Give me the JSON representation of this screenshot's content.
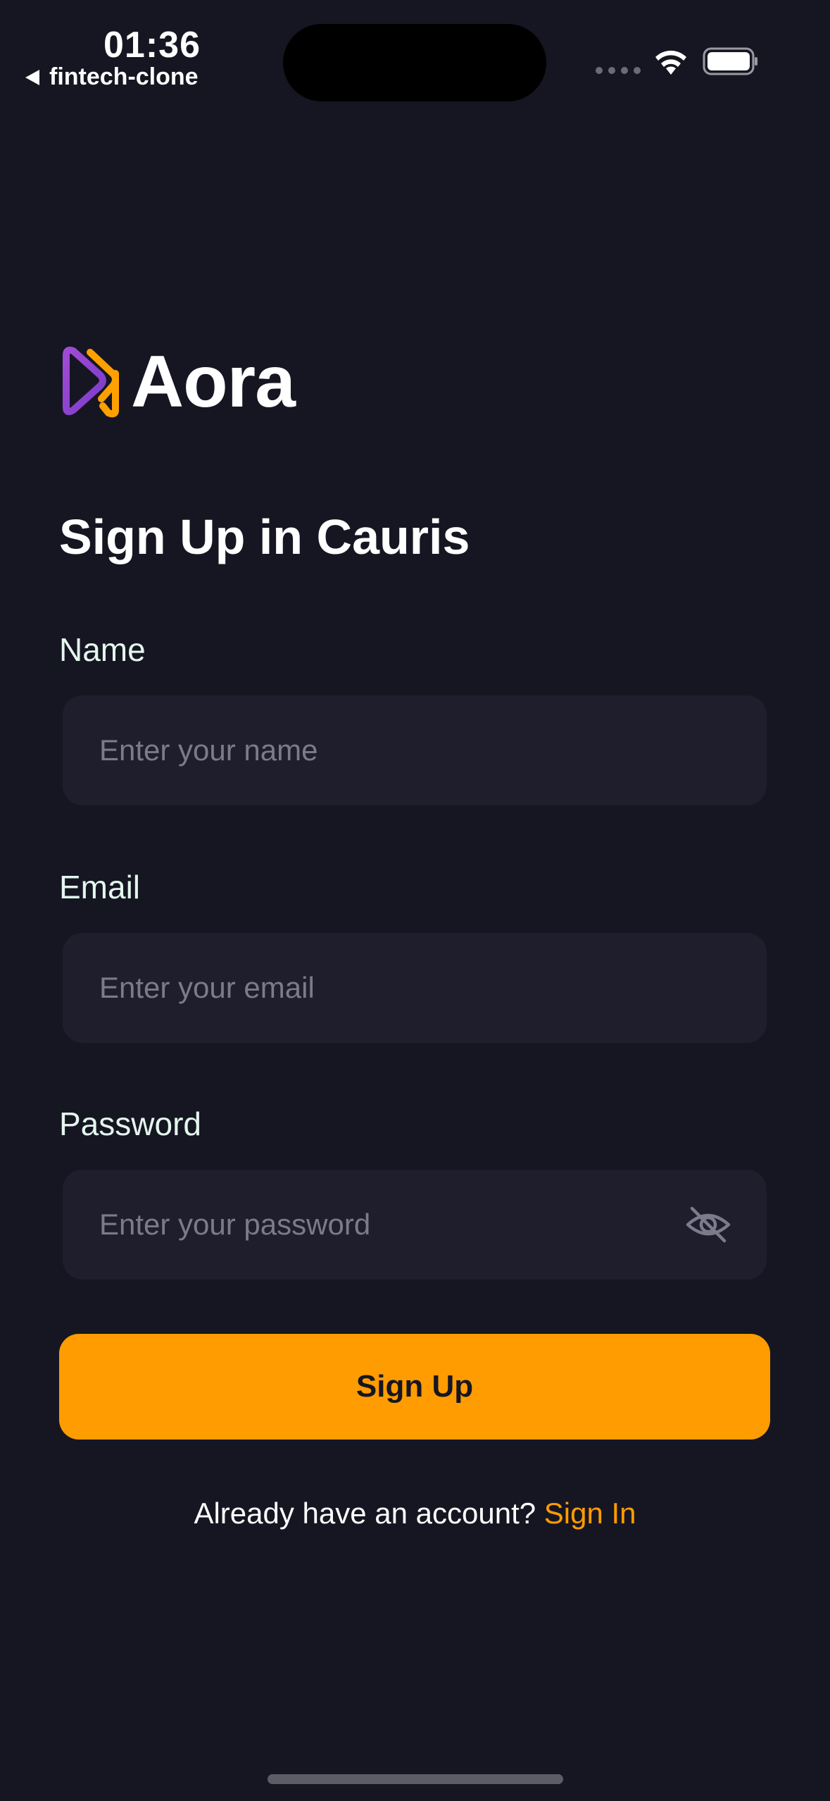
{
  "status_bar": {
    "time": "01:36",
    "back_label": "fintech-clone"
  },
  "logo": {
    "text": "Aora",
    "icon": "aora-logo-icon"
  },
  "heading": "Sign Up in Cauris",
  "fields": {
    "name": {
      "label": "Name",
      "placeholder": "Enter your name"
    },
    "email": {
      "label": "Email",
      "placeholder": "Enter your email"
    },
    "password": {
      "label": "Password",
      "placeholder": "Enter your password",
      "icon": "eye-off-icon"
    }
  },
  "submit_label": "Sign Up",
  "footer": {
    "prompt": "Already have an account?",
    "link": "Sign In"
  },
  "colors": {
    "background": "#161622",
    "field_background": "#1e1e2d",
    "accent": "#ff9c01",
    "label": "#e4f6ee",
    "placeholder": "#7b7b8b"
  }
}
